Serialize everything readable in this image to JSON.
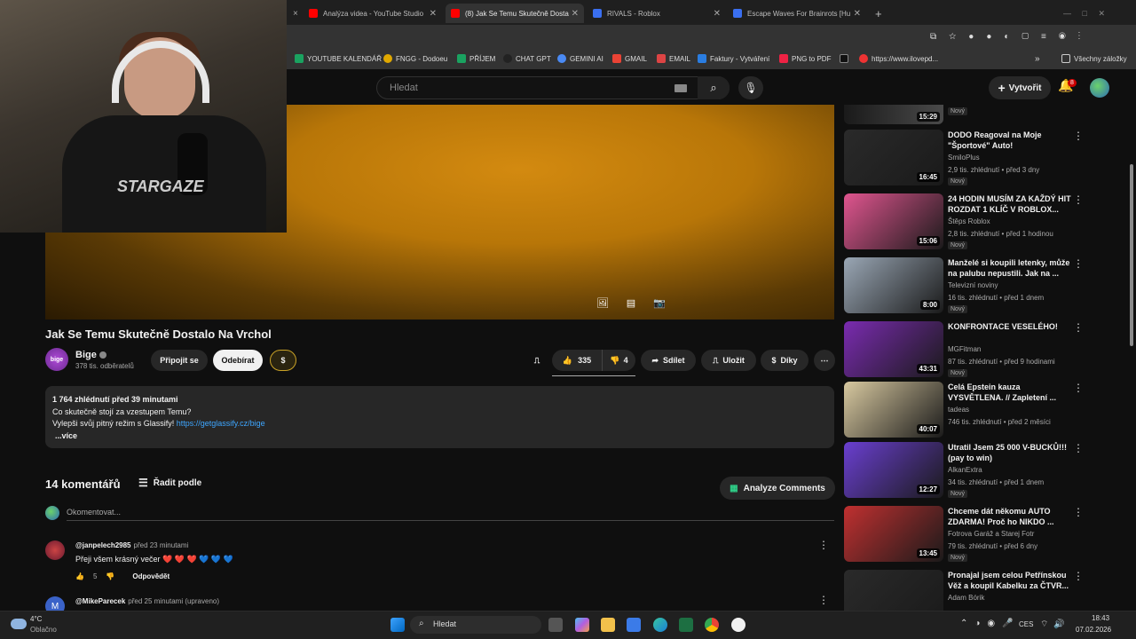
{
  "browser": {
    "tabs": [
      {
        "label": "Analýza videa - YouTube Studio",
        "color": "#ff0000"
      },
      {
        "label": "(8) Jak Se Temu Skutečně Dosta",
        "color": "#ff0000"
      },
      {
        "label": "RIVALS - Roblox",
        "color": "#3a6ff0"
      },
      {
        "label": "Escape Waves For Brainrots [Hu",
        "color": "#3a6ff0"
      }
    ],
    "new_tab": "+",
    "bookmarks": [
      {
        "label": "YOUTUBE KALENDÁŘ",
        "color": "#1aa260"
      },
      {
        "label": "FNGG - Dodoeu",
        "color": "#e0a800"
      },
      {
        "label": "PŘÍJEM",
        "color": "#1aa260"
      },
      {
        "label": "CHAT GPT",
        "color": "#222222"
      },
      {
        "label": "GEMINI AI",
        "color": "#4a8af4"
      },
      {
        "label": "GMAIL",
        "color": "#ea4335"
      },
      {
        "label": "EMAIL",
        "color": "#d44"
      },
      {
        "label": "Faktury - Vytváření",
        "color": "#2a7de1"
      },
      {
        "label": "PNG to PDF",
        "color": "#e24"
      },
      {
        "label": "",
        "color": "#111111"
      },
      {
        "label": "https://www.ilovepd...",
        "color": "#e33"
      }
    ],
    "all_bookmarks": "Všechny záložky"
  },
  "yt": {
    "search_placeholder": "Hledat",
    "create_label": "Vytvořit",
    "notifications": "8"
  },
  "video": {
    "title": "Jak Se Temu Skutečně Dostalo Na Vrchol",
    "channel": "Bige",
    "subscribers": "378 tis. odběratelů",
    "join_label": "Připojit se",
    "subscribe_label": "Odebírat",
    "likes": "335",
    "dislikes": "4",
    "share_label": "Sdílet",
    "save_label": "Uložit",
    "thanks_label": "Díky",
    "description": {
      "stats": "1 764 zhlédnutí  před 39 minutami",
      "line1": "Co skutečně stojí za vzestupem Temu?",
      "line2": "Vylepši svůj pitný režim s Glassify! ",
      "link": "https://getglassify.cz/bige",
      "more": "...více"
    }
  },
  "comments": {
    "count_label": "14 komentářů",
    "sort_label": "Řadit podle",
    "analyze_label": "Analyze Comments",
    "add_placeholder": "Okomentovat...",
    "reply_label": "Odpovědět",
    "items": [
      {
        "author": "@janpelech2985",
        "time": "před 23 minutami",
        "text": "Přeji všem krásný večer ❤️ ❤️ ❤️ 💙 💙 💙",
        "likes": "5"
      },
      {
        "author": "@MikeParecek",
        "time": "před 25 minutami (upraveno)"
      }
    ]
  },
  "sidebar": {
    "top_badge": "Nový",
    "top_duration": "15:29",
    "items": [
      {
        "title": "DODO Reagoval na Moje \"Športové\" Auto!",
        "channel": "SmiloPlus",
        "meta": "2,9 tis. zhlédnutí • před 3 dny",
        "badge": "Nový",
        "duration": "16:45",
        "thumb": "#2a2a2a"
      },
      {
        "title": "24 HODIN MUSÍM ZA KAŽDÝ HIT ROZDAT 1 KLÍČ V ROBLOX...",
        "channel": "Štěps Roblox",
        "meta": "2,8 tis. zhlédnutí • před 1 hodinou",
        "badge": "Nový",
        "duration": "15:06",
        "thumb": "#e0558f"
      },
      {
        "title": "Manželé si koupili letenky, může na palubu nepustili. Jak na ...",
        "channel": "Televizní noviny",
        "meta": "16 tis. zhlédnutí • před 1 dnem",
        "badge": "Nový",
        "duration": "8:00",
        "thumb": "#9aa7b5"
      },
      {
        "title": "KONFRONTACE VESELÉHO!",
        "channel": "MGFitman",
        "meta": "87 tis. zhlédnutí • před 9 hodinami",
        "badge": "Nový",
        "duration": "43:31",
        "thumb": "#7a2bb0"
      },
      {
        "title": "Celá Epstein kauza VYSVĚTLENA. // Zapletení ...",
        "channel": "tadeas",
        "meta": "746 tis. zhlédnutí • před 2 měsíci",
        "badge": "",
        "duration": "40:07",
        "thumb": "#d8c9a0"
      },
      {
        "title": "Utratil Jsem 25 000 V-BUCKŮ!!! (pay to win)",
        "channel": "AlkanExtra",
        "meta": "34 tis. zhlédnutí • před 1 dnem",
        "badge": "Nový",
        "duration": "12:27",
        "thumb": "#6a3fd0"
      },
      {
        "title": "Chceme dát někomu AUTO ZDARMA! Proč ho NIKDO ...",
        "channel": "Fotrova Garáž a Starej Fotr",
        "meta": "79 tis. zhlédnutí • před 6 dny",
        "badge": "Nový",
        "duration": "13:45",
        "thumb": "#c03030"
      },
      {
        "title": "Pronajal jsem celou Petřínskou Věž a koupil Kabelku za ČTVR...",
        "channel": "Adam Bórik",
        "meta": "",
        "badge": "",
        "duration": "",
        "thumb": "#2a2a2a"
      }
    ]
  },
  "taskbar": {
    "weather_temp": "4°C",
    "weather_desc": "Oblačno",
    "search_label": "Hledat",
    "lang": "CES",
    "time": "18:43",
    "date": "07.02.2026"
  },
  "webcam": {
    "shirt_text": "STARGAZE"
  }
}
